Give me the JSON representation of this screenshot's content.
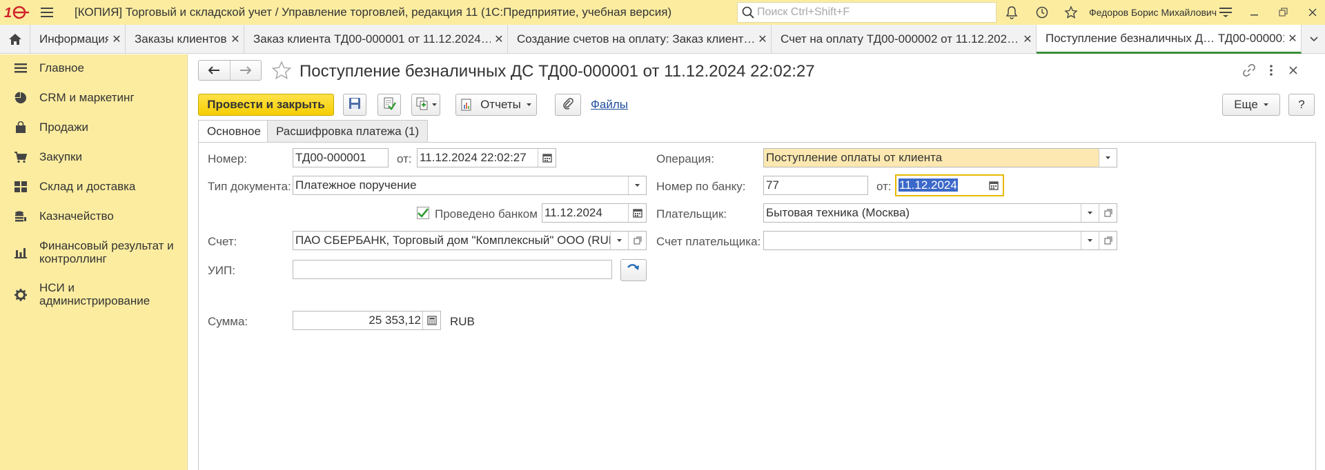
{
  "titlebar": {
    "title": "[КОПИЯ] Торговый и складской учет / Управление торговлей, редакция 11  (1С:Предприятие, учебная версия)",
    "search_placeholder": "Поиск Ctrl+Shift+F",
    "user": "Федоров Борис Михайлович"
  },
  "tabs": [
    {
      "label": "Информация"
    },
    {
      "label": "Заказы клиентов"
    },
    {
      "label": "Заказ клиента ТД00-000001 от 11.12.2024…"
    },
    {
      "label": "Создание счетов на оплату: Заказ клиент…"
    },
    {
      "label": "Счет на оплату ТД00-000002 от 11.12.202…"
    },
    {
      "label": "Поступление безналичных Д… ТД00-000001"
    }
  ],
  "sidebar": {
    "items": [
      {
        "label": "Главное"
      },
      {
        "label": "CRM и маркетинг"
      },
      {
        "label": "Продажи"
      },
      {
        "label": "Закупки"
      },
      {
        "label": "Склад и доставка"
      },
      {
        "label": "Казначейство"
      },
      {
        "label": "Финансовый результат и контроллинг"
      },
      {
        "label": "НСИ и администрирование"
      }
    ]
  },
  "doc": {
    "title": "Поступление безналичных ДС ТД00-000001 от 11.12.2024 22:02:27"
  },
  "toolbar": {
    "post_close": "Провести и закрыть",
    "reports": "Отчеты",
    "files": "Файлы",
    "more": "Еще",
    "help": "?"
  },
  "inner_tabs": [
    "Основное",
    "Расшифровка платежа (1)"
  ],
  "form": {
    "number_label": "Номер:",
    "number_value": "ТД00-000001",
    "from_label": "от:",
    "date_value": "11.12.2024 22:02:27",
    "doctype_label": "Тип документа:",
    "doctype_value": "Платежное поручение",
    "posted_label": "Проведено банком",
    "posted_checked": true,
    "posted_date": "11.12.2024",
    "account_label": "Счет:",
    "account_value": "ПАО СБЕРБАНК, Торговый дом \"Комплексный\" ООО (RUB)",
    "uip_label": "УИП:",
    "uip_value": "",
    "sum_label": "Сумма:",
    "sum_value": "25 353,12",
    "currency": "RUB",
    "operation_label": "Операция:",
    "operation_value": "Поступление оплаты от клиента",
    "bank_number_label": "Номер по банку:",
    "bank_number_value": "77",
    "bank_from_label": "от:",
    "bank_date_value": "11.12.2024",
    "payer_label": "Плательщик:",
    "payer_value": "Бытовая техника (Москва)",
    "payer_account_label": "Счет плательщика:",
    "payer_account_value": ""
  },
  "colors": {
    "sidebar_bg": "#fbeca0",
    "primary_button": "#f5cd00",
    "active_tab_underline": "#3a8d3a",
    "link": "#1f4e9d"
  }
}
